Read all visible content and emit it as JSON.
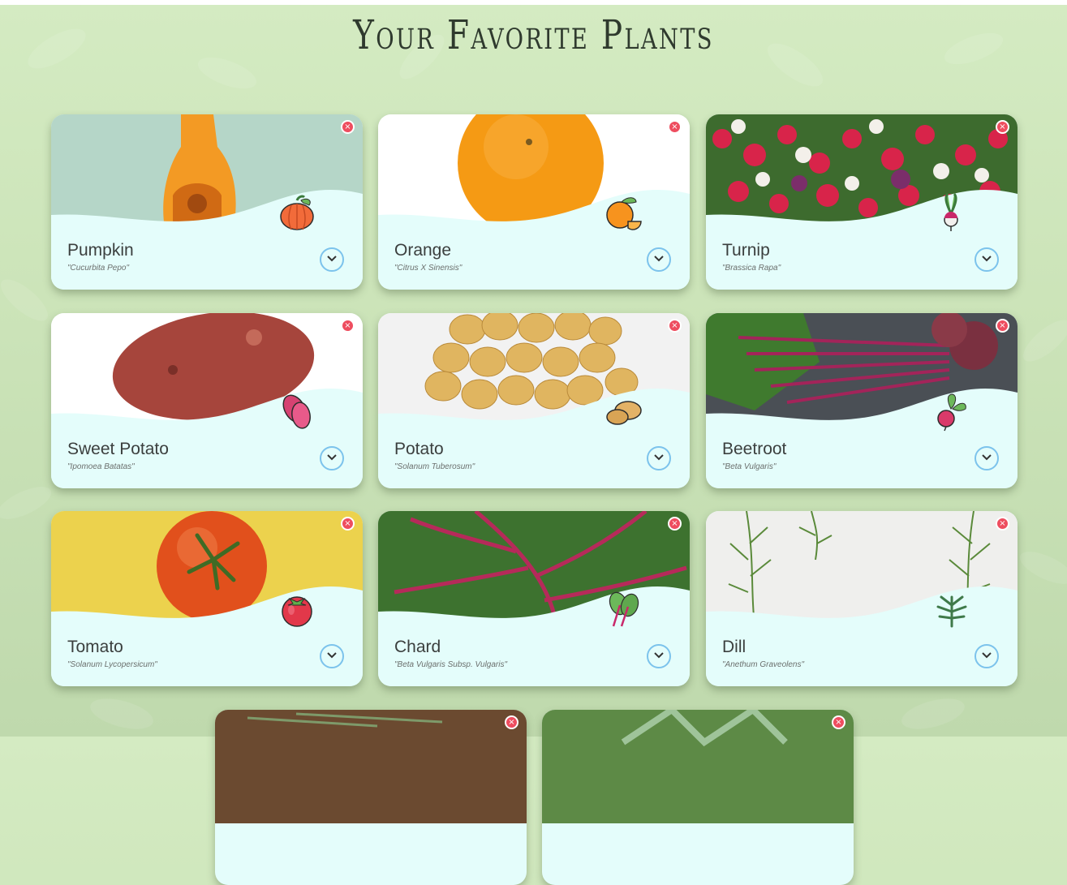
{
  "page": {
    "title": "Your Favorite Plants"
  },
  "plants": [
    {
      "name": "Pumpkin",
      "scientific": "\"Cucurbita Pepo\"",
      "icon": "pumpkin-icon"
    },
    {
      "name": "Orange",
      "scientific": "\"Citrus X Sinensis\"",
      "icon": "orange-icon"
    },
    {
      "name": "Turnip",
      "scientific": "\"Brassica Rapa\"",
      "icon": "turnip-icon"
    },
    {
      "name": "Sweet Potato",
      "scientific": "\"Ipomoea Batatas\"",
      "icon": "sweet-potato-icon"
    },
    {
      "name": "Potato",
      "scientific": "\"Solanum Tuberosum\"",
      "icon": "potato-icon"
    },
    {
      "name": "Beetroot",
      "scientific": "\"Beta Vulgaris\"",
      "icon": "beetroot-icon"
    },
    {
      "name": "Tomato",
      "scientific": "\"Solanum Lycopersicum\"",
      "icon": "tomato-icon"
    },
    {
      "name": "Chard",
      "scientific": "\"Beta Vulgaris Subsp. Vulgaris\"",
      "icon": "chard-icon"
    },
    {
      "name": "Dill",
      "scientific": "\"Anethum Graveolens\"",
      "icon": "dill-icon"
    }
  ],
  "colors": {
    "card_body": "#e4fdfb",
    "close": "#ee4d5f",
    "expand_border": "#7cc3ec",
    "background": "#cce4b9"
  }
}
